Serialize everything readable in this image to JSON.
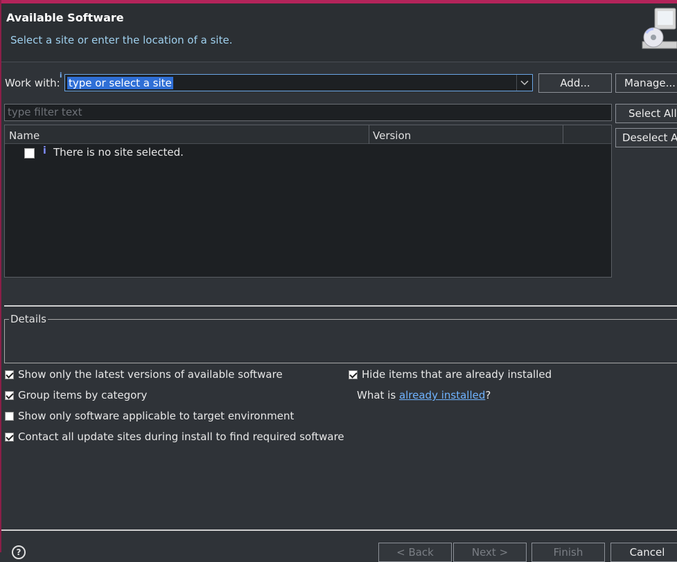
{
  "header": {
    "title": "Available Software",
    "subtitle": "Select a site or enter the location of a site."
  },
  "work_with": {
    "label": "Work with:",
    "value": "type or select a site",
    "info_marker": "i"
  },
  "buttons": {
    "add": "Add...",
    "manage": "Manage...",
    "select_all": "Select All",
    "deselect_all": "Deselect A"
  },
  "filter": {
    "placeholder": "type filter text"
  },
  "table": {
    "columns": [
      "Name",
      "Version"
    ],
    "rows": [
      {
        "checked": false,
        "icon": "info-icon",
        "text": "There is no site selected."
      }
    ]
  },
  "details": {
    "legend": "Details"
  },
  "options": {
    "show_latest": {
      "label": "Show only the latest versions of available software",
      "checked": true
    },
    "group_by_category": {
      "label": "Group items by category",
      "checked": true
    },
    "target_env": {
      "label": "Show only software applicable to target environment",
      "checked": false
    },
    "contact_sites": {
      "label": "Contact all update sites during install to find required software",
      "checked": true
    },
    "hide_installed": {
      "label": "Hide items that are already installed",
      "checked": true
    }
  },
  "what_is": {
    "prefix": "What is ",
    "link": "already installed",
    "suffix": "?"
  },
  "footer": {
    "help": "?",
    "back": "< Back",
    "next": "Next >",
    "finish": "Finish",
    "cancel": "Cancel"
  },
  "colors": {
    "accent": "#b3245a",
    "link": "#6fb3ff",
    "selection": "#2f6fd6"
  }
}
